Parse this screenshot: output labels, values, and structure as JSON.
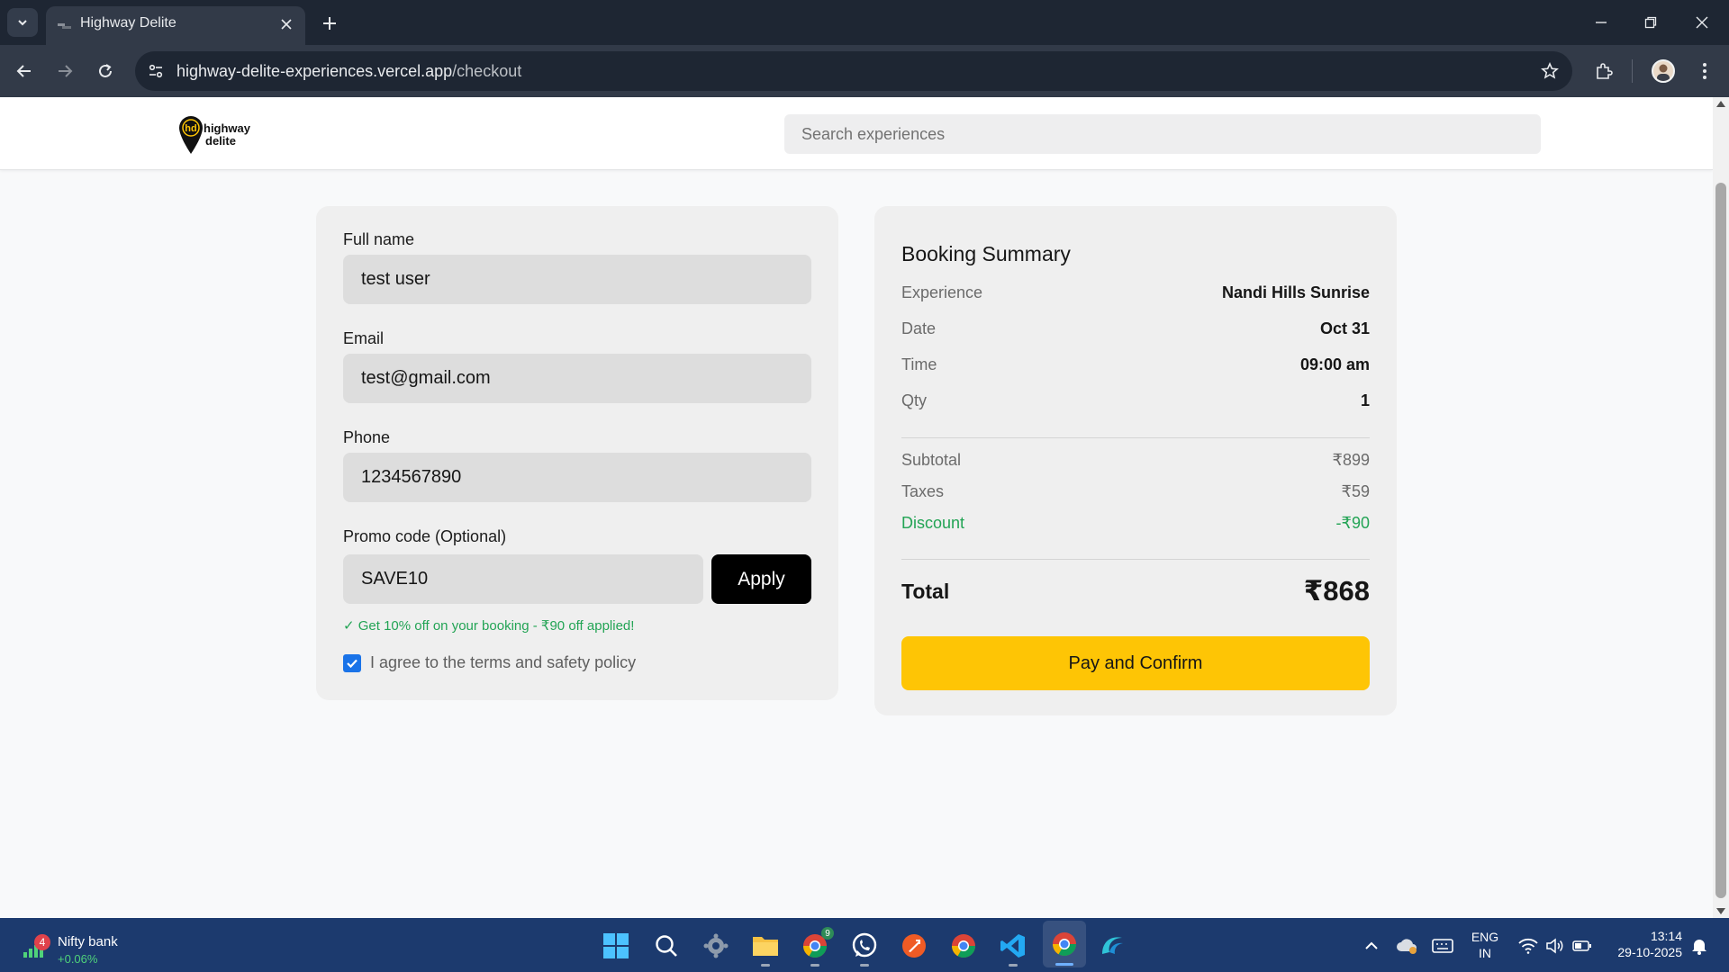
{
  "browser": {
    "tab_title": "Highway Delite",
    "url_host": "highway-delite-experiences.vercel.app",
    "url_path": "/checkout"
  },
  "header": {
    "logo_line1": "highway",
    "logo_line2": "delite",
    "search_placeholder": "Search experiences"
  },
  "form": {
    "full_name_label": "Full name",
    "full_name_value": "test user",
    "email_label": "Email",
    "email_value": "test@gmail.com",
    "phone_label": "Phone",
    "phone_value": "1234567890",
    "promo_label": "Promo code (Optional)",
    "promo_value": "SAVE10",
    "apply_label": "Apply",
    "promo_message": "✓ Get 10% off on your booking - ₹90 off applied!",
    "agree_text": "I agree to the terms and safety policy",
    "agree_checked": true
  },
  "summary": {
    "title": "Booking Summary",
    "experience_label": "Experience",
    "experience_value": "Nandi Hills Sunrise",
    "date_label": "Date",
    "date_value": "Oct 31",
    "time_label": "Time",
    "time_value": "09:00 am",
    "qty_label": "Qty",
    "qty_value": "1",
    "subtotal_label": "Subtotal",
    "subtotal_value": "₹899",
    "taxes_label": "Taxes",
    "taxes_value": "₹59",
    "discount_label": "Discount",
    "discount_value": "-₹90",
    "total_label": "Total",
    "total_value": "₹868",
    "pay_label": "Pay and Confirm"
  },
  "taskbar": {
    "widget_badge": "4",
    "widget_name": "Nifty bank",
    "widget_change": "+0.06%",
    "chrome_badge": "9",
    "lang_line1": "ENG",
    "lang_line2": "IN",
    "time": "13:14",
    "date": "29-10-2025"
  },
  "colors": {
    "accent_yellow": "#fec505",
    "discount_green": "#23a455",
    "taskbar_blue": "#1c3a6e"
  }
}
